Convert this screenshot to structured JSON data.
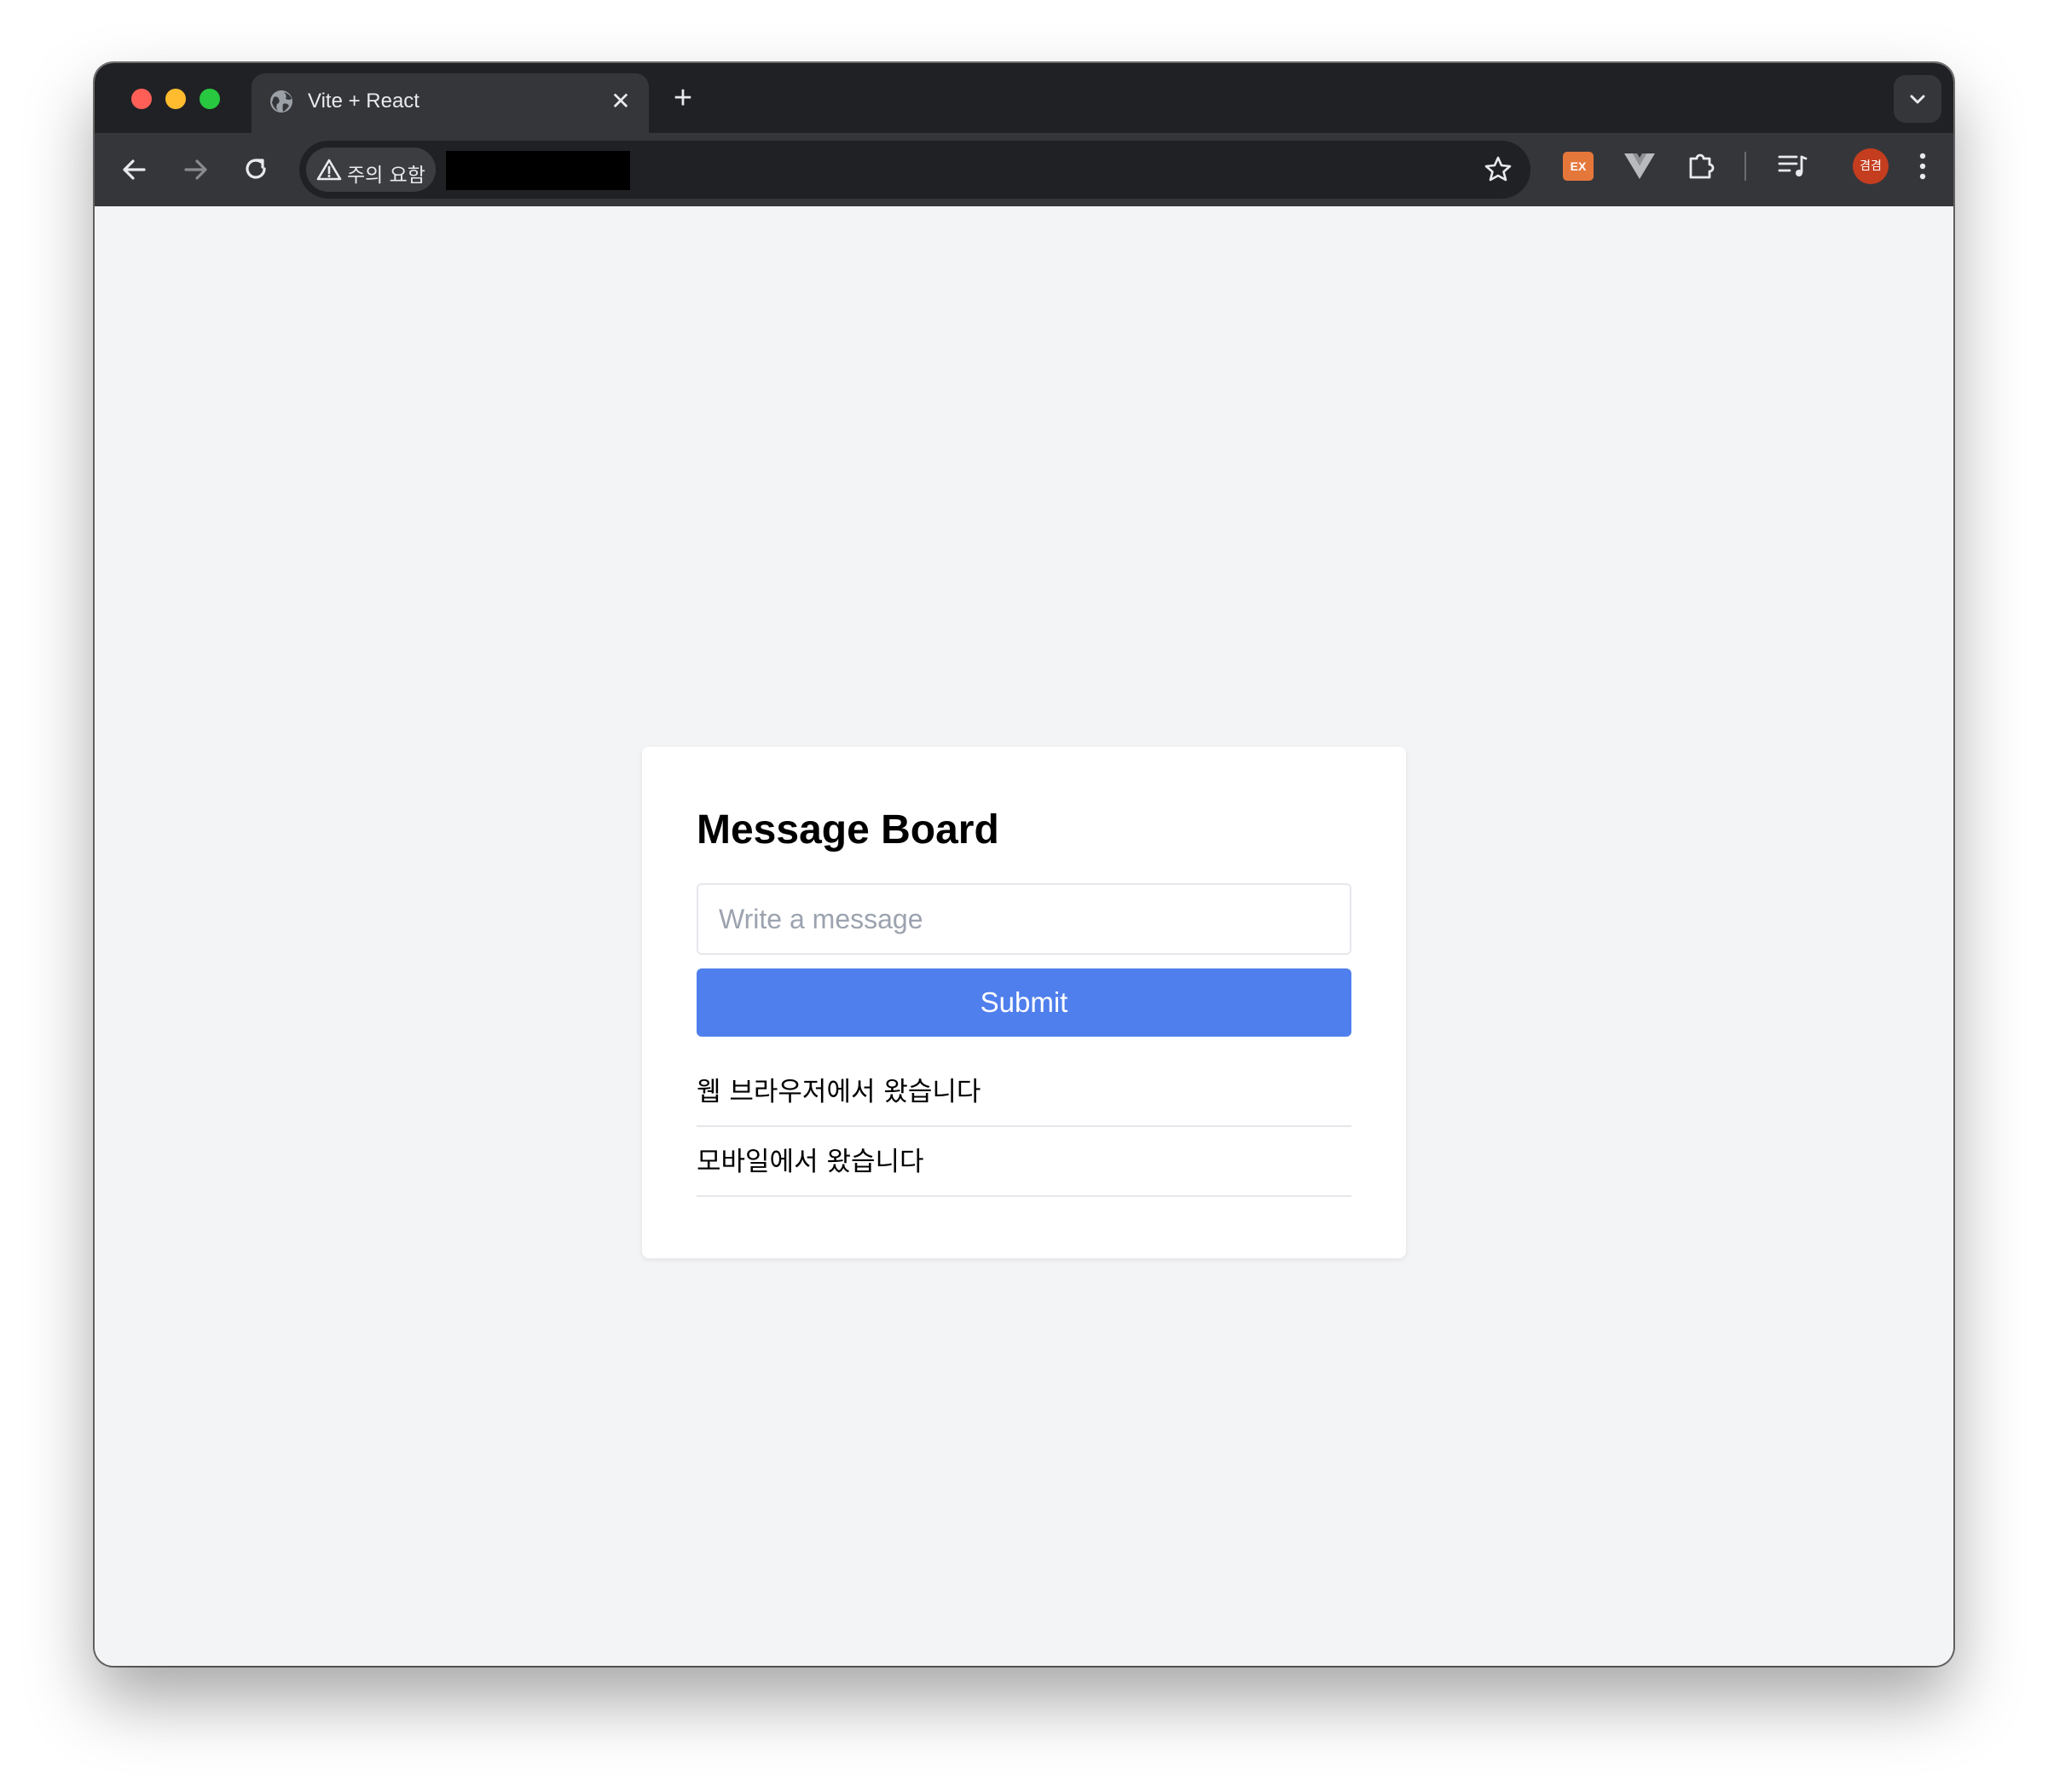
{
  "browser": {
    "tab": {
      "title": "Vite + React",
      "close_label": "✕"
    },
    "new_tab_label": "+",
    "security_chip": "주의 요함",
    "avatar_text": "겸겸",
    "extension_badge": "EX",
    "icons": [
      "globe-icon",
      "close-icon",
      "plus-icon",
      "chevron-down-icon",
      "back-arrow-icon",
      "forward-arrow-icon",
      "reload-icon",
      "warning-icon",
      "star-icon",
      "ex-extension-icon",
      "vue-devtools-icon",
      "puzzle-extension-icon",
      "media-controls-icon",
      "more-vert-icon"
    ],
    "colors": {
      "tabbar": "#202124",
      "toolbar": "#35363a",
      "traffic_red": "#ff5f57",
      "traffic_yellow": "#febc2e",
      "traffic_green": "#28c840"
    }
  },
  "page": {
    "title": "Message Board",
    "input": {
      "placeholder": "Write a message",
      "value": ""
    },
    "submit_label": "Submit",
    "messages": [
      "웹 브라우저에서 왔습니다",
      "모바일에서 왔습니다"
    ],
    "colors": {
      "background": "#f3f4f6",
      "card": "#ffffff",
      "button": "#4f7fec"
    }
  }
}
